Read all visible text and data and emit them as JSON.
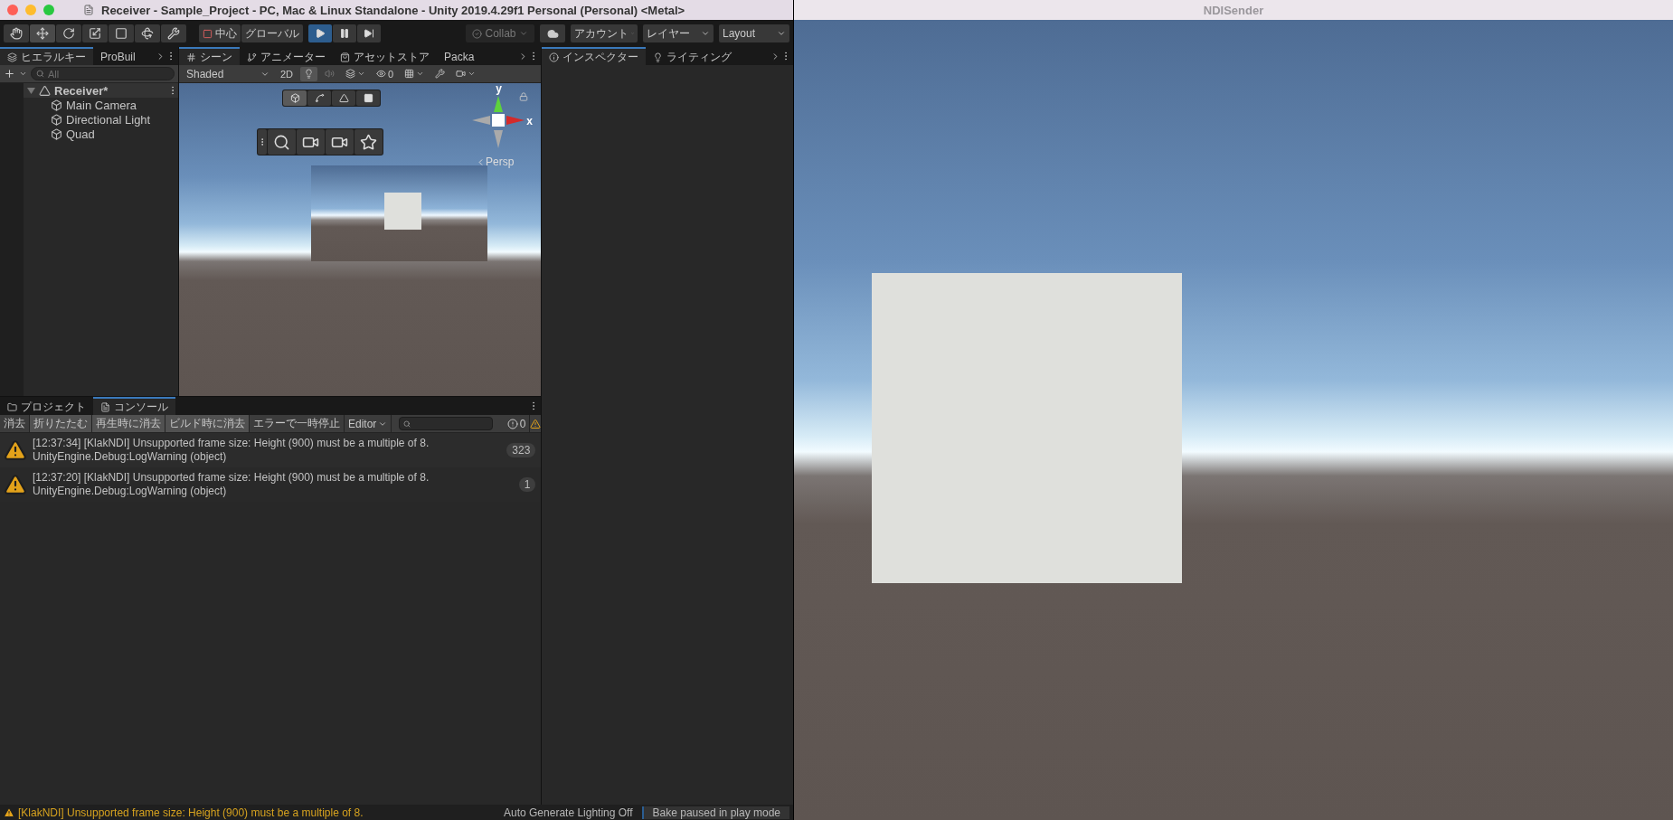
{
  "unity_window": {
    "title": "Receiver - Sample_Project - PC, Mac & Linux Standalone - Unity 2019.4.29f1 Personal (Personal) <Metal>"
  },
  "toolbar": {
    "tools": [
      {
        "kind": "hand",
        "selected": false
      },
      {
        "kind": "move",
        "selected": true
      },
      {
        "kind": "rotate",
        "selected": false
      },
      {
        "kind": "scale",
        "selected": false
      },
      {
        "kind": "rect",
        "selected": false
      },
      {
        "kind": "transform",
        "selected": false
      },
      {
        "kind": "custom",
        "selected": false
      }
    ],
    "pivot": [
      "中心",
      "グローバル"
    ],
    "play": [
      {
        "kind": "play",
        "on": true
      },
      {
        "kind": "pause",
        "on": false
      },
      {
        "kind": "step",
        "on": false
      }
    ],
    "collab": "Collab",
    "account": "アカウント",
    "layers": "レイヤー",
    "layout": "Layout"
  },
  "hierarchy": {
    "tabs": [
      {
        "label": "ヒエラルキー",
        "selected": true
      },
      {
        "label": "ProBuil",
        "selected": false
      }
    ],
    "search": {
      "placeholder": "All"
    },
    "tree": [
      {
        "name": "Receiver*",
        "expanded": true,
        "children": [
          {
            "name": "Main Camera"
          },
          {
            "name": "Directional Light"
          },
          {
            "name": "Quad"
          }
        ]
      }
    ]
  },
  "scene": {
    "tabs": [
      {
        "label": "シーン",
        "selected": true
      },
      {
        "label": "アニメーター",
        "selected": false
      },
      {
        "label": "アセットストア",
        "selected": false
      },
      {
        "label": "Packa",
        "selected": false
      }
    ],
    "shading": "Shaded",
    "mode_2d": "2D",
    "lighting_on": true,
    "hidden_count": "0",
    "axis_y": "y",
    "axis_x": "x",
    "projection": "Persp"
  },
  "inspector": {
    "tabs": [
      {
        "label": "インスペクター",
        "selected": true
      },
      {
        "label": "ライティング",
        "selected": false
      }
    ]
  },
  "console": {
    "tabs": [
      {
        "label": "プロジェクト",
        "selected": false
      },
      {
        "label": "コンソール",
        "selected": true
      }
    ],
    "buttons": [
      {
        "kind": "button",
        "label": "消去"
      },
      {
        "kind": "toggle",
        "label": "折りたたむ",
        "on": true
      },
      {
        "kind": "toggle",
        "label": "再生時に消去",
        "on": true
      },
      {
        "kind": "toggle",
        "label": "ビルド時に消去",
        "on": true
      },
      {
        "kind": "toggle",
        "label": "エラーで一時停止",
        "on": false
      },
      {
        "kind": "dropdown",
        "label": "Editor"
      }
    ],
    "error_count": "0",
    "entries": [
      {
        "message": "[12:37:34] [KlakNDI] Unsupported frame size: Height (900) must be a multiple of 8.",
        "trace": "UnityEngine.Debug:LogWarning (object)",
        "count": "323"
      },
      {
        "message": "[12:37:20] [KlakNDI] Unsupported frame size: Height (900) must be a multiple of 8.",
        "trace": "UnityEngine.Debug:LogWarning (object)",
        "count": "1"
      }
    ]
  },
  "status_bar": {
    "message": "[KlakNDI] Unsupported frame size: Height (900) must be a multiple of 8.",
    "lighting": "Auto Generate Lighting Off",
    "bake": "Bake paused in play mode"
  },
  "ndi_window": {
    "title": "NDISender"
  }
}
